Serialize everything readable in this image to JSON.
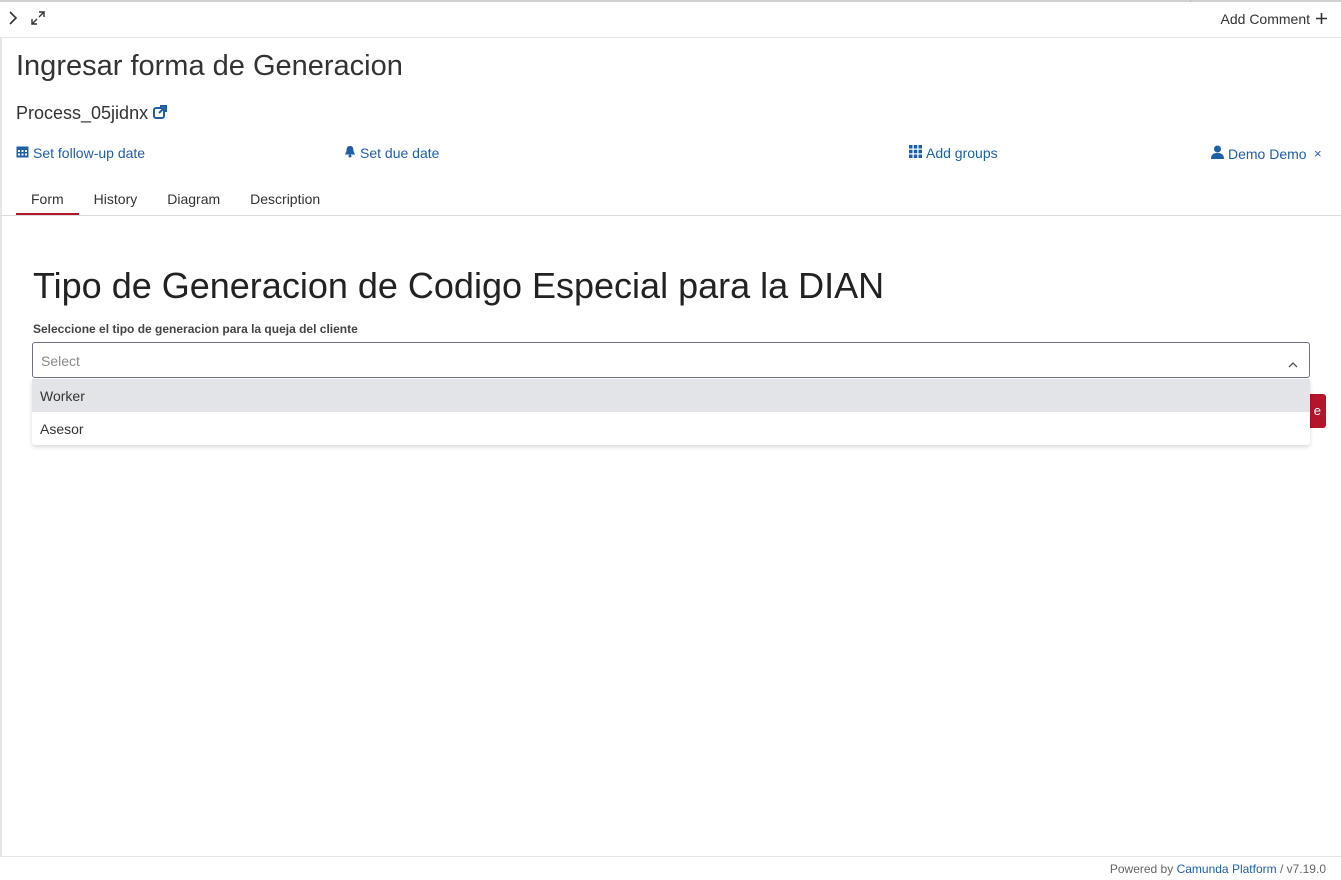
{
  "topbar": {
    "add_comment_label": "Add Comment",
    "add_comment_icon": "plus-icon",
    "collapse_icon": "chevron-right-icon",
    "expand_icon": "expand-icon"
  },
  "task": {
    "name": "Ingresar forma de Generacion",
    "process_name": "Process_05jidnx",
    "process_link_icon": "external-link-icon"
  },
  "actions": {
    "follow_up": "Set follow-up date",
    "due_date": "Set due date",
    "add_groups": "Add groups",
    "assignee": "Demo Demo",
    "remove_assignee": "×"
  },
  "tabs": [
    {
      "label": "Form",
      "active": true
    },
    {
      "label": "History",
      "active": false
    },
    {
      "label": "Diagram",
      "active": false
    },
    {
      "label": "Description",
      "active": false
    }
  ],
  "form": {
    "title": "Tipo de Generacion de Codigo Especial para la DIAN",
    "field_label": "Seleccione el tipo de generacion para la queja del cliente",
    "select_placeholder": "Select",
    "options": [
      "Worker",
      "Asesor"
    ],
    "highlighted_option": "Worker",
    "submit_partial": "e"
  },
  "footer": {
    "powered_by": "Powered by",
    "platform": "Camunda Platform",
    "version": " / v7.19.0"
  },
  "colors": {
    "link": "#1f5fa8",
    "accent": "#b5152b",
    "highlight": "#e3e4e8"
  }
}
